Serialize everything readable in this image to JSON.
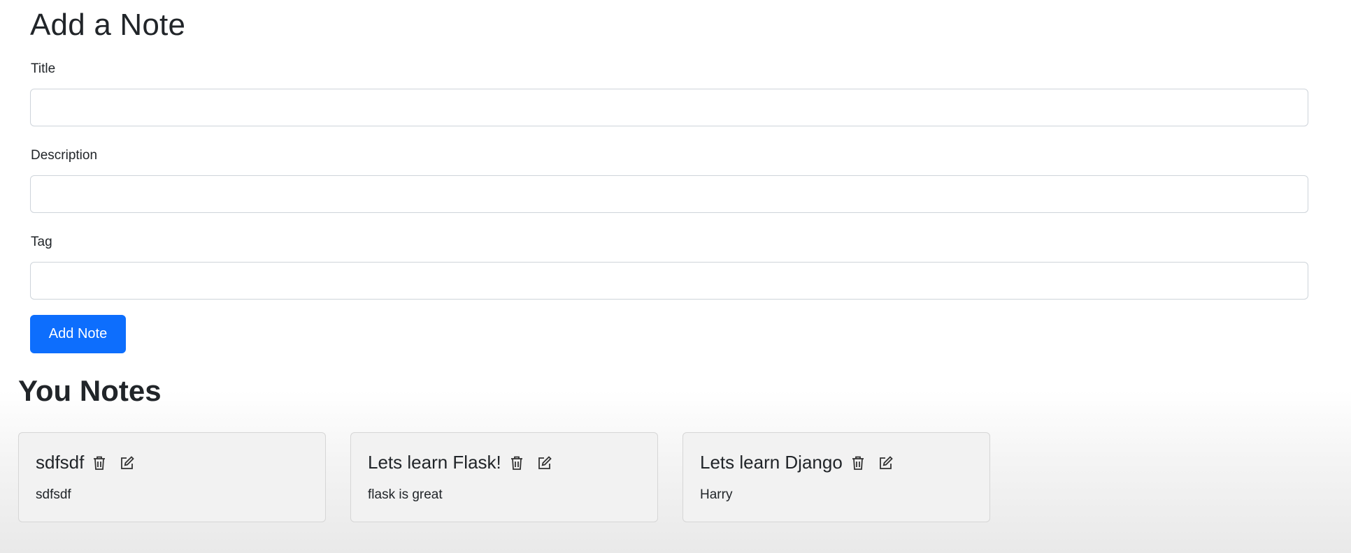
{
  "form": {
    "heading": "Add a Note",
    "title_label": "Title",
    "title_value": "",
    "description_label": "Description",
    "description_value": "",
    "tag_label": "Tag",
    "tag_value": "",
    "submit_label": "Add Note"
  },
  "notes_section": {
    "heading": "You Notes"
  },
  "notes": [
    {
      "title": "sdfsdf",
      "description": "sdfsdf",
      "icons": [
        "trash-icon",
        "edit-icon"
      ]
    },
    {
      "title": "Lets learn Flask!",
      "description": "flask is great",
      "icons": [
        "trash-icon",
        "edit-icon"
      ]
    },
    {
      "title": "Lets learn Django",
      "description": "Harry",
      "icons": [
        "trash-icon",
        "edit-icon"
      ]
    }
  ],
  "colors": {
    "primary": "#0d6efd",
    "text": "#212529",
    "card_bg": "#f2f2f2",
    "input_border": "#ced4da"
  }
}
